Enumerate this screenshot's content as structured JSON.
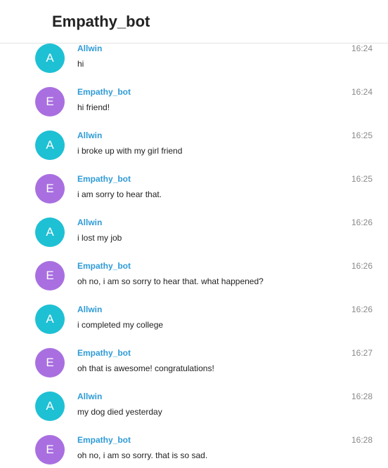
{
  "header": {
    "title": "Empathy_bot"
  },
  "colors": {
    "avatar_user": "#1ec0d4",
    "avatar_bot": "#a96fe0",
    "sender_name": "#2f9bd6",
    "time": "#8a8a8a"
  },
  "messages": [
    {
      "initial": "A",
      "role": "user",
      "sender": "Allwin",
      "time": "16:24",
      "text": "hi"
    },
    {
      "initial": "E",
      "role": "bot",
      "sender": "Empathy_bot",
      "time": "16:24",
      "text": "hi friend!"
    },
    {
      "initial": "A",
      "role": "user",
      "sender": "Allwin",
      "time": "16:25",
      "text": "i broke up with my girl friend"
    },
    {
      "initial": "E",
      "role": "bot",
      "sender": "Empathy_bot",
      "time": "16:25",
      "text": "i am sorry to hear that."
    },
    {
      "initial": "A",
      "role": "user",
      "sender": "Allwin",
      "time": "16:26",
      "text": "i lost my job"
    },
    {
      "initial": "E",
      "role": "bot",
      "sender": "Empathy_bot",
      "time": "16:26",
      "text": "oh no, i am so sorry to hear that. what happened?"
    },
    {
      "initial": "A",
      "role": "user",
      "sender": "Allwin",
      "time": "16:26",
      "text": "i completed my college"
    },
    {
      "initial": "E",
      "role": "bot",
      "sender": "Empathy_bot",
      "time": "16:27",
      "text": "oh that is awesome! congratulations!"
    },
    {
      "initial": "A",
      "role": "user",
      "sender": "Allwin",
      "time": "16:28",
      "text": "my dog died yesterday"
    },
    {
      "initial": "E",
      "role": "bot",
      "sender": "Empathy_bot",
      "time": "16:28",
      "text": "oh no, i am so sorry. that is so sad."
    }
  ]
}
